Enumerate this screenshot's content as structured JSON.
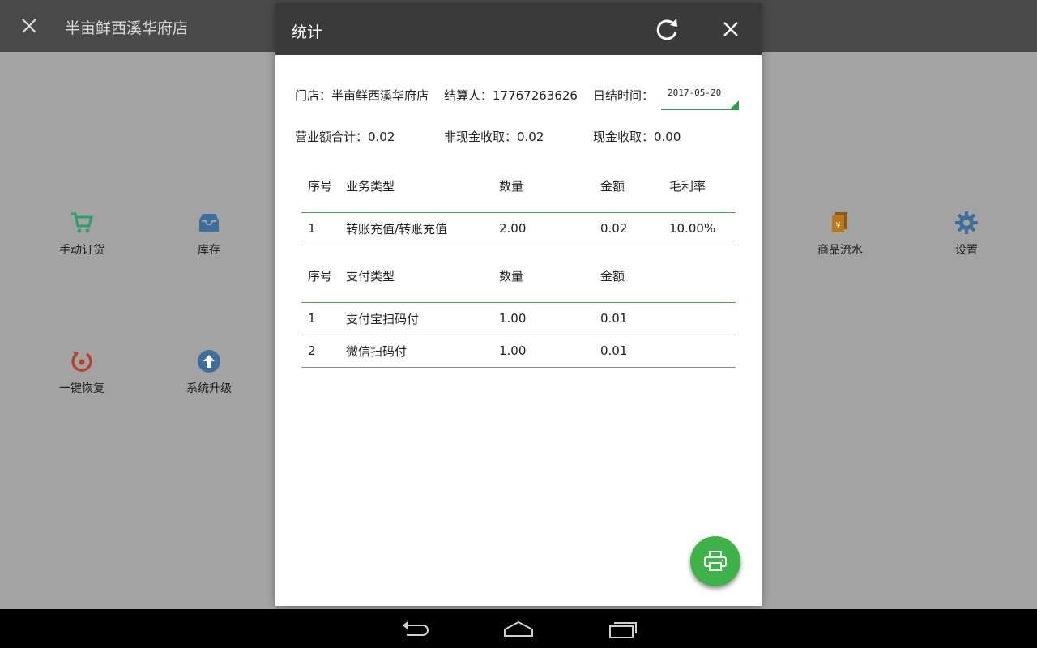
{
  "app": {
    "title": "半亩鲜西溪华府店",
    "tiles": [
      {
        "label": "手动订货",
        "icon": "cart-icon"
      },
      {
        "label": "库存",
        "icon": "inbox-icon"
      },
      {
        "label": "商品流水",
        "icon": "receipt-icon"
      },
      {
        "label": "设置",
        "icon": "gear-icon"
      },
      {
        "label": "一键恢复",
        "icon": "restore-icon"
      },
      {
        "label": "系统升级",
        "icon": "upgrade-icon"
      }
    ]
  },
  "dialog": {
    "title": "统计",
    "store_label": "门店：半亩鲜西溪华府店",
    "settler_label": "结算人：17767263626",
    "date_label": "日结时间：",
    "date_value": "2017-05-20",
    "revenue_total": "营业额合计：0.02",
    "noncash": "非现金收取：0.02",
    "cash": "现金收取：0.00",
    "business_table": {
      "headers": [
        "序号",
        "业务类型",
        "数量",
        "金额",
        "毛利率"
      ],
      "rows": [
        [
          "1",
          "转账充值/转账充值",
          "2.00",
          "0.02",
          "10.00%"
        ]
      ]
    },
    "payment_table": {
      "headers": [
        "序号",
        "支付类型",
        "数量",
        "金额"
      ],
      "rows": [
        [
          "1",
          "支付宝扫码付",
          "1.00",
          "0.01"
        ],
        [
          "2",
          "微信扫码付",
          "1.00",
          "0.01"
        ]
      ]
    }
  },
  "colors": {
    "accent_green": "#3fb34a",
    "header_dark": "#3a3a3a",
    "tile_green": "#2e9e6a",
    "tile_blue": "#3d6e9c",
    "tile_red": "#b5402e",
    "tile_orange": "#b8781c"
  }
}
